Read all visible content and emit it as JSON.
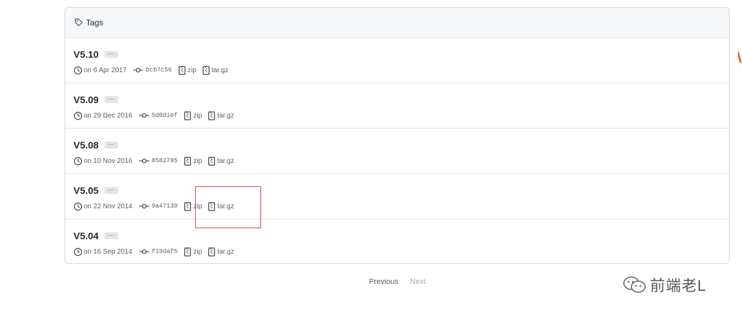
{
  "header": {
    "title": "Tags",
    "icon": "tag-icon"
  },
  "tags": [
    {
      "name": "V5.10",
      "date": "on 6 Apr 2017",
      "sha": "bcb7c56",
      "zip": "zip",
      "targz": "tar.gz"
    },
    {
      "name": "V5.09",
      "date": "on 29 Dec 2016",
      "sha": "5d0d1ef",
      "zip": "zip",
      "targz": "tar.gz"
    },
    {
      "name": "V5.08",
      "date": "on 10 Nov 2016",
      "sha": "8582785",
      "zip": "zip",
      "targz": "tar.gz"
    },
    {
      "name": "V5.05",
      "date": "on 22 Nov 2014",
      "sha": "9a47139",
      "zip": "zip",
      "targz": "tar.gz"
    },
    {
      "name": "V5.04",
      "date": "on 16 Sep 2014",
      "sha": "f19daf5",
      "zip": "zip",
      "targz": "tar.gz"
    }
  ],
  "dots_label": "…",
  "pagination": {
    "previous": "Previous",
    "next": "Next"
  },
  "watermark": {
    "text": "前端老L"
  },
  "colors": {
    "highlight": "#e04747",
    "accent_orange": "#f26522"
  }
}
